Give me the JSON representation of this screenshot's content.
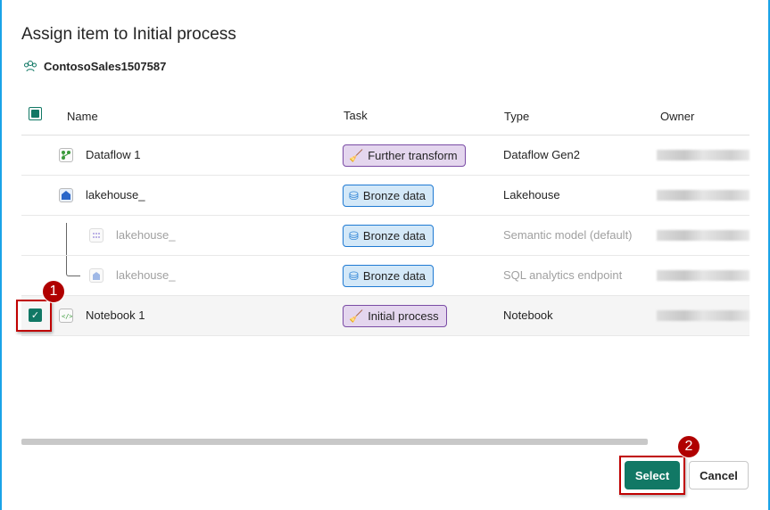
{
  "dialog": {
    "title": "Assign item to Initial process",
    "workspace": "ContosoSales1507587"
  },
  "columns": {
    "name": "Name",
    "task": "Task",
    "type": "Type",
    "owner": "Owner"
  },
  "rows": [
    {
      "name": "Dataflow 1",
      "task": "Further transform",
      "type": "Dataflow Gen2",
      "icon": "dataflow-icon",
      "selected": false
    },
    {
      "name": "lakehouse_",
      "task": "Bronze data",
      "type": "Lakehouse",
      "icon": "lakehouse-icon",
      "selected": false
    },
    {
      "name": "lakehouse_",
      "task": "Bronze data",
      "type": "Semantic model (default)",
      "icon": "semantic-model-icon",
      "selected": false
    },
    {
      "name": "lakehouse_",
      "task": "Bronze data",
      "type": "SQL analytics endpoint",
      "icon": "sql-endpoint-icon",
      "selected": false
    },
    {
      "name": "Notebook 1",
      "task": "Initial process",
      "type": "Notebook",
      "icon": "notebook-icon",
      "selected": true
    }
  ],
  "buttons": {
    "select": "Select",
    "cancel": "Cancel"
  },
  "callouts": {
    "one": "1",
    "two": "2"
  },
  "colors": {
    "accent": "#117865",
    "callout": "#b00000"
  }
}
